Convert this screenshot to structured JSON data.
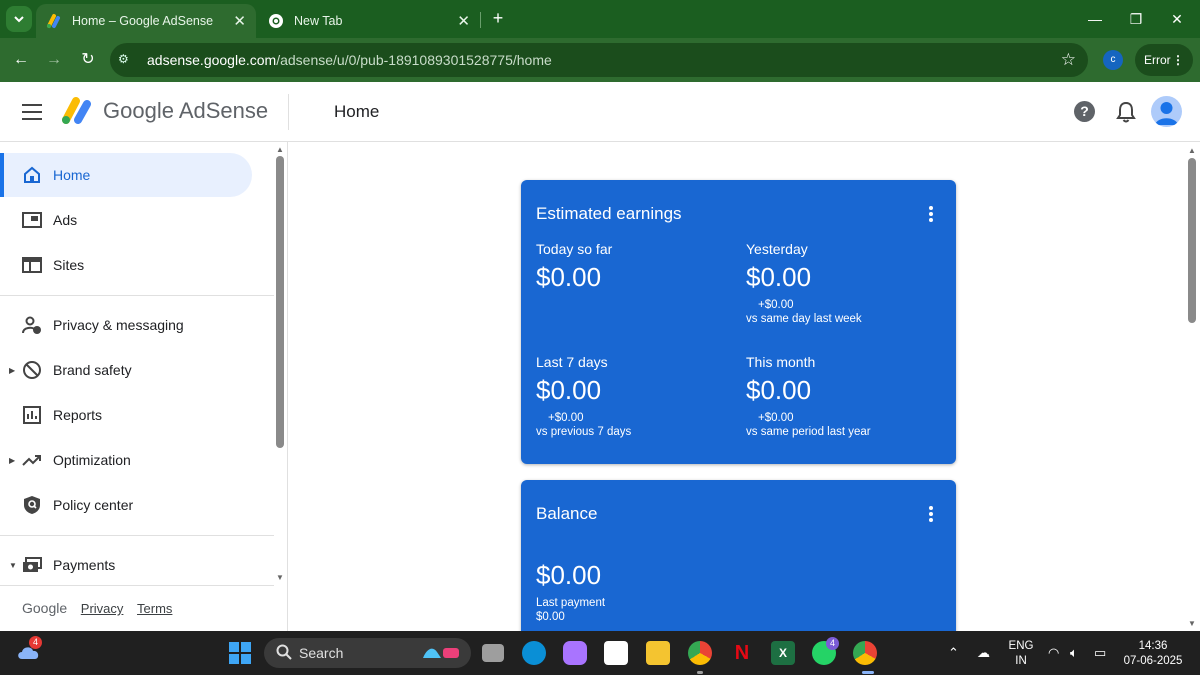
{
  "browser": {
    "tabs": [
      {
        "title": "Home – Google AdSense",
        "active": true
      },
      {
        "title": "New Tab",
        "active": false
      }
    ],
    "url_host": "adsense.google.com",
    "url_path": "/adsense/u/0/pub-1891089301528775/home",
    "profile_initial": "c",
    "status_chip": "Error",
    "icons": [
      "tab-search-icon",
      "adsense-favicon",
      "chrome-favicon",
      "close-icon",
      "plus-icon",
      "minimize-icon",
      "restore-icon",
      "back-icon",
      "forward-icon",
      "reload-icon",
      "site-info-icon",
      "star-icon",
      "kebab-icon"
    ]
  },
  "header": {
    "brand": "Google AdSense",
    "page_title": "Home",
    "help": "?",
    "icons": [
      "menu-icon",
      "adsense-logo-icon",
      "help-icon",
      "bell-icon",
      "avatar"
    ]
  },
  "sidebar": {
    "items": [
      {
        "label": "Home",
        "icon": "home-icon",
        "active": true
      },
      {
        "label": "Ads",
        "icon": "ads-icon"
      },
      {
        "label": "Sites",
        "icon": "sites-icon"
      },
      {
        "label": "Privacy & messaging",
        "icon": "privacy-icon"
      },
      {
        "label": "Brand safety",
        "icon": "block-icon",
        "expandable": true
      },
      {
        "label": "Reports",
        "icon": "reports-icon"
      },
      {
        "label": "Optimization",
        "icon": "trending-icon",
        "expandable": true
      },
      {
        "label": "Policy center",
        "icon": "policy-shield-icon"
      },
      {
        "label": "Payments",
        "icon": "payments-icon",
        "expanded": true
      }
    ],
    "footer": {
      "google": "Google",
      "privacy": "Privacy",
      "terms": "Terms"
    }
  },
  "earnings_card": {
    "title": "Estimated earnings",
    "today": {
      "label": "Today so far",
      "value": "$0.00"
    },
    "yesterday": {
      "label": "Yesterday",
      "value": "$0.00",
      "change": "+$0.00",
      "compare": "vs same day last week"
    },
    "last7": {
      "label": "Last 7 days",
      "value": "$0.00",
      "change": "+$0.00",
      "compare": "vs previous 7 days"
    },
    "month": {
      "label": "This month",
      "value": "$0.00",
      "change": "+$0.00",
      "compare": "vs same period last year"
    }
  },
  "balance_card": {
    "title": "Balance",
    "value": "$0.00",
    "last_payment_label": "Last payment",
    "last_payment_value": "$0.00"
  },
  "taskbar": {
    "search_label": "Search",
    "weather_badge": "4",
    "whatsapp_badge": "4",
    "lang_top": "ENG",
    "lang_bottom": "IN",
    "time": "14:36",
    "date": "07-06-2025"
  },
  "colors": {
    "chrome_dark": "#1b5e20",
    "chrome_toolbar": "#2e6b2f",
    "card_blue": "#1967d2",
    "accent": "#1a73e8"
  }
}
